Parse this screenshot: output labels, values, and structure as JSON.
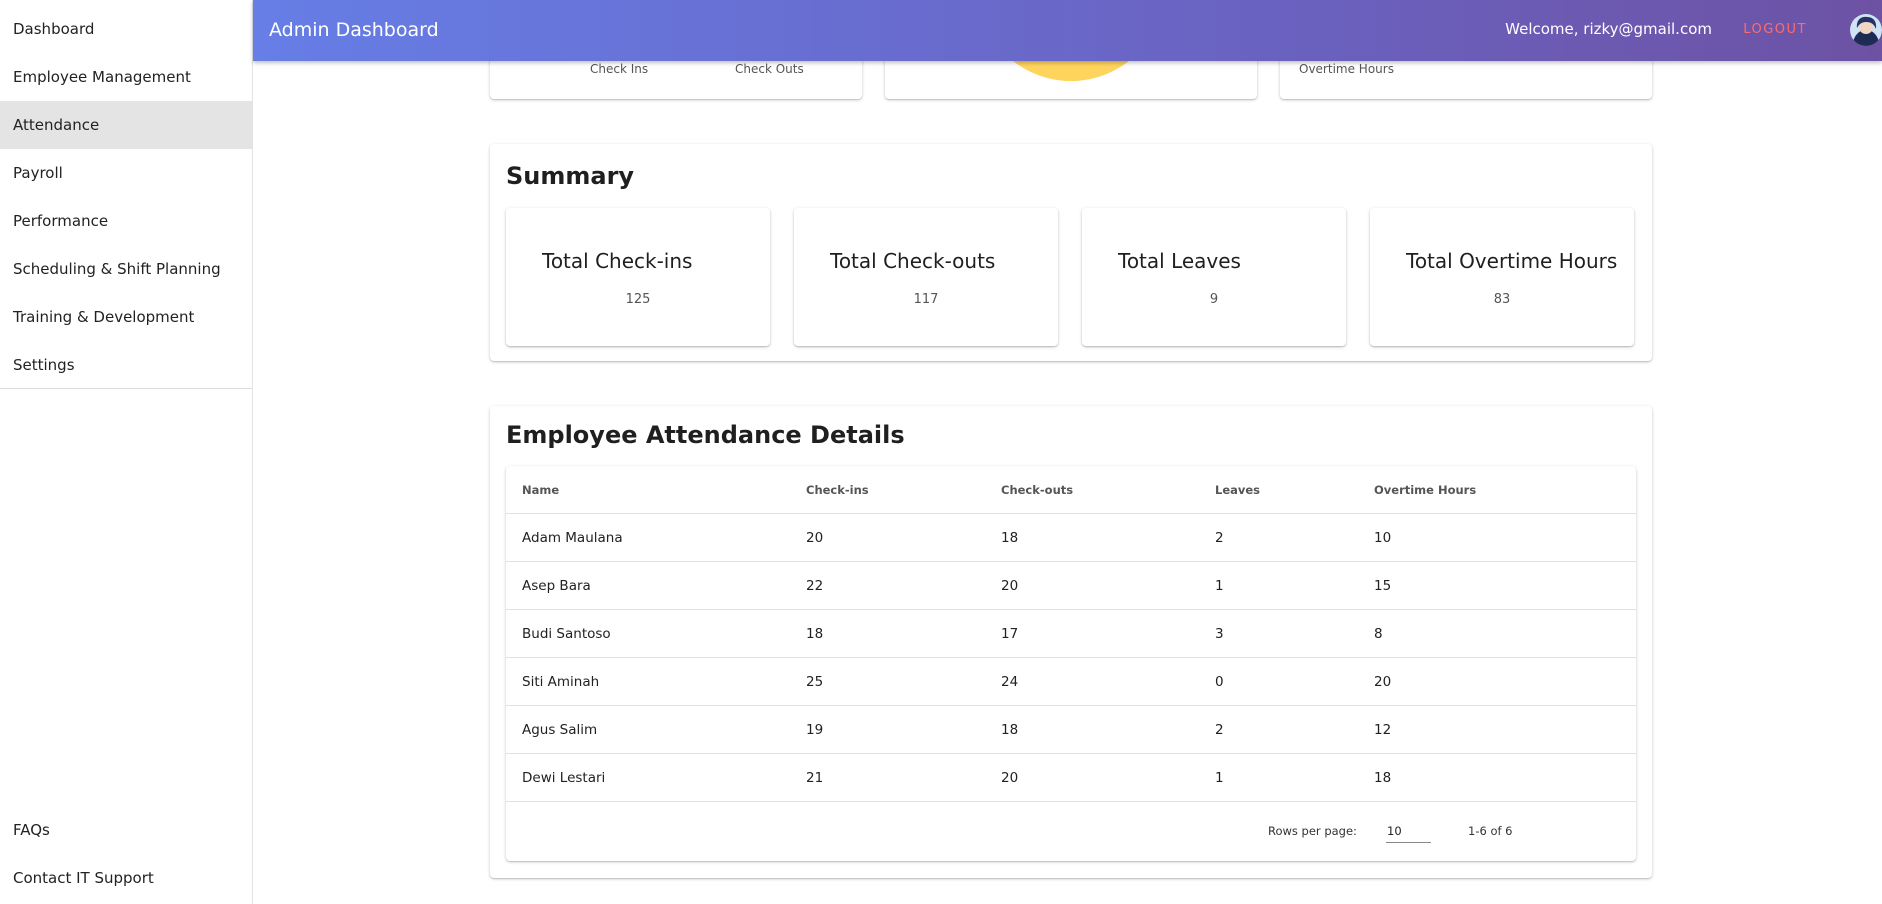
{
  "sidebar": {
    "items": [
      {
        "label": "Dashboard"
      },
      {
        "label": "Employee Management"
      },
      {
        "label": "Attendance"
      },
      {
        "label": "Payroll"
      },
      {
        "label": "Performance"
      },
      {
        "label": "Scheduling & Shift Planning"
      },
      {
        "label": "Training & Development"
      },
      {
        "label": "Settings"
      }
    ],
    "bottom_items": [
      {
        "label": "FAQs"
      },
      {
        "label": "Contact IT Support"
      }
    ],
    "active_item": "Attendance"
  },
  "header": {
    "title": "Admin Dashboard",
    "welcome": "Welcome, rizky@gmail.com",
    "logout_label": "LOGOUT",
    "gradient_start": "#667ee6",
    "gradient_end": "#6d52a4",
    "logout_color": "#ff6b6b"
  },
  "top_cards": {
    "checkins_label": "Check Ins",
    "checkouts_label": "Check Outs",
    "overtime_label": "Overtime Hours",
    "pie_color": "#ffd45c"
  },
  "summary": {
    "title": "Summary",
    "stats": [
      {
        "title": "Total Check-ins",
        "value": "125"
      },
      {
        "title": "Total Check-outs",
        "value": "117"
      },
      {
        "title": "Total Leaves",
        "value": "9"
      },
      {
        "title": "Total Overtime Hours",
        "value": "83"
      }
    ]
  },
  "details": {
    "title": "Employee Attendance Details",
    "columns": [
      "Name",
      "Check-ins",
      "Check-outs",
      "Leaves",
      "Overtime Hours"
    ],
    "rows": [
      [
        "Adam Maulana",
        "20",
        "18",
        "2",
        "10"
      ],
      [
        "Asep Bara",
        "22",
        "20",
        "1",
        "15"
      ],
      [
        "Budi Santoso",
        "18",
        "17",
        "3",
        "8"
      ],
      [
        "Siti Aminah",
        "25",
        "24",
        "0",
        "20"
      ],
      [
        "Agus Salim",
        "19",
        "18",
        "2",
        "12"
      ],
      [
        "Dewi Lestari",
        "21",
        "20",
        "1",
        "18"
      ]
    ],
    "pagination": {
      "rows_per_page_label": "Rows per page:",
      "rows_per_page_value": "10",
      "range": "1-6 of 6"
    }
  }
}
